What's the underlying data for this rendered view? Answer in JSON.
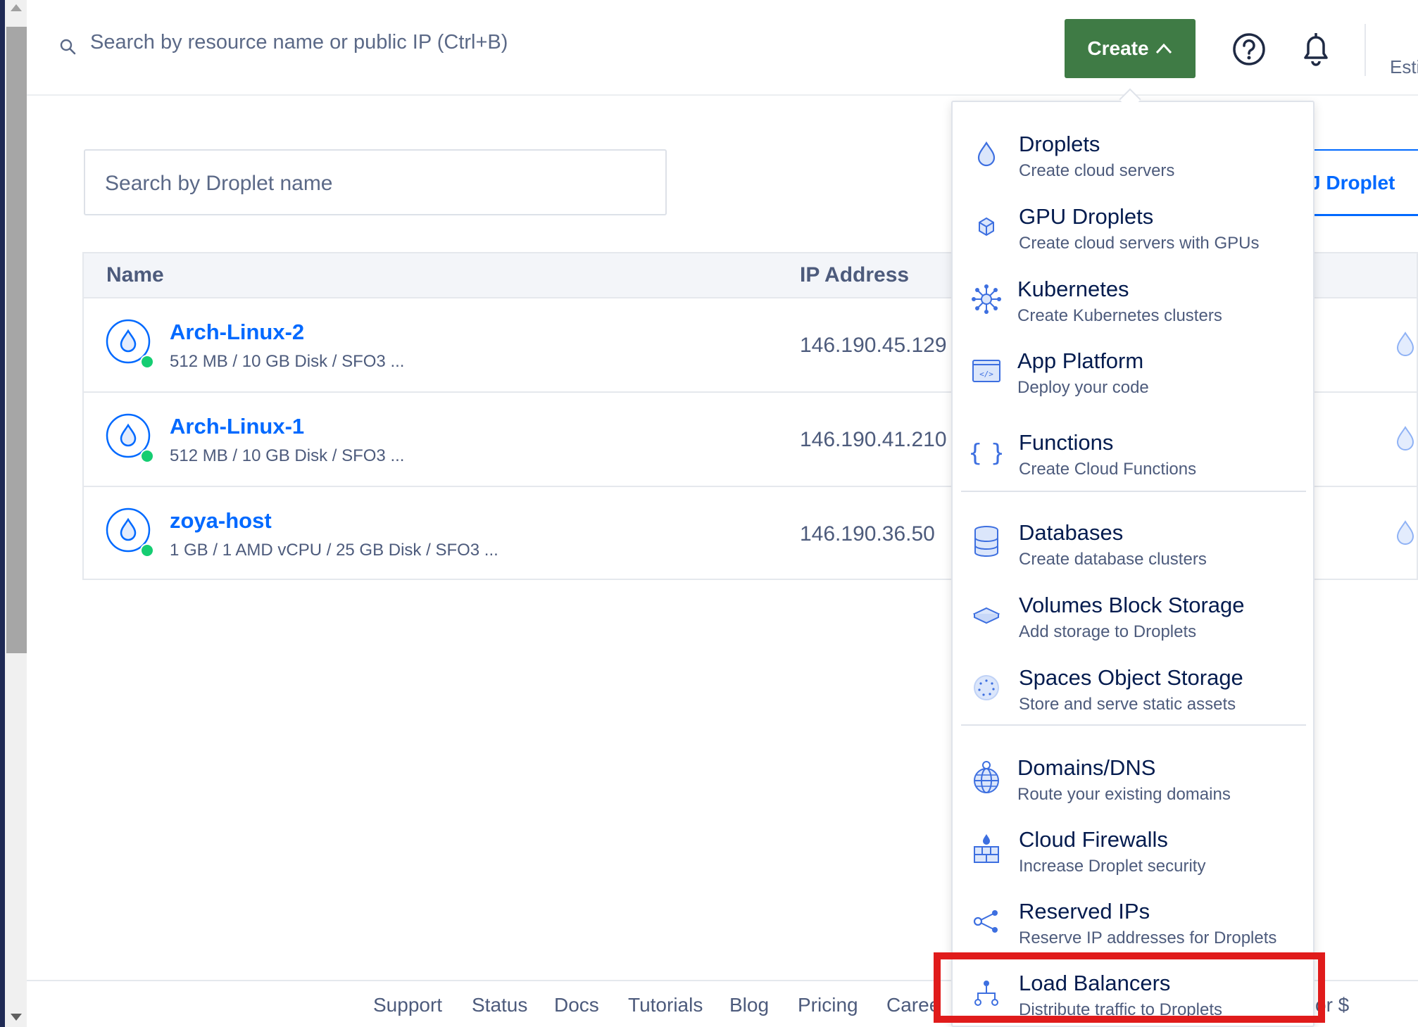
{
  "topbar": {
    "search_placeholder": "Search by resource name or public IP (Ctrl+B)",
    "create_label": "Create",
    "est_text": "Esti"
  },
  "page": {
    "heading_fragment": "",
    "droplet_search_placeholder": "Search by Droplet name",
    "right_tab_text": "J Droplet"
  },
  "table": {
    "headers": {
      "name": "Name",
      "ip": "IP Address"
    },
    "rows": [
      {
        "name": "Arch-Linux-2",
        "spec": "512 MB / 10 GB Disk / SFO3 ...",
        "ip": "146.190.45.129"
      },
      {
        "name": "Arch-Linux-1",
        "spec": "512 MB / 10 GB Disk / SFO3 ...",
        "ip": "146.190.41.210"
      },
      {
        "name": "zoya-host",
        "spec": "1 GB / 1 AMD vCPU / 25 GB Disk / SFO3 ...",
        "ip": "146.190.36.50"
      }
    ]
  },
  "menu": {
    "items": [
      {
        "title": "Droplets",
        "subtitle": "Create cloud servers",
        "icon": "droplet-icon"
      },
      {
        "title": "GPU Droplets",
        "subtitle": "Create cloud servers with GPUs",
        "icon": "gpu-icon"
      },
      {
        "title": "Kubernetes",
        "subtitle": "Create Kubernetes clusters",
        "icon": "kubernetes-icon"
      },
      {
        "title": "App Platform",
        "subtitle": "Deploy your code",
        "icon": "app-platform-icon"
      },
      {
        "title": "Functions",
        "subtitle": "Create Cloud Functions",
        "icon": "functions-icon"
      },
      {
        "title": "Databases",
        "subtitle": "Create database clusters",
        "icon": "database-icon"
      },
      {
        "title": "Volumes Block Storage",
        "subtitle": "Add storage to Droplets",
        "icon": "volume-icon"
      },
      {
        "title": "Spaces Object Storage",
        "subtitle": "Store and serve static assets",
        "icon": "spaces-icon"
      },
      {
        "title": "Domains/DNS",
        "subtitle": "Route your existing domains",
        "icon": "globe-icon"
      },
      {
        "title": "Cloud Firewalls",
        "subtitle": "Increase Droplet security",
        "icon": "firewall-icon"
      },
      {
        "title": "Reserved IPs",
        "subtitle": "Reserve IP addresses for Droplets",
        "icon": "share-icon"
      },
      {
        "title": "Load Balancers",
        "subtitle": "Distribute traffic to Droplets",
        "icon": "load-balancer-icon"
      }
    ]
  },
  "footer": {
    "links": [
      "Support",
      "Status",
      "Docs",
      "Tutorials",
      "Blog",
      "Pricing",
      "Caree"
    ],
    "right_text": "or $"
  },
  "colors": {
    "create_button": "#3f7b45",
    "link_blue": "#0069ff",
    "highlight": "#e01b1b",
    "icon_blue": "#3d6fe0"
  }
}
